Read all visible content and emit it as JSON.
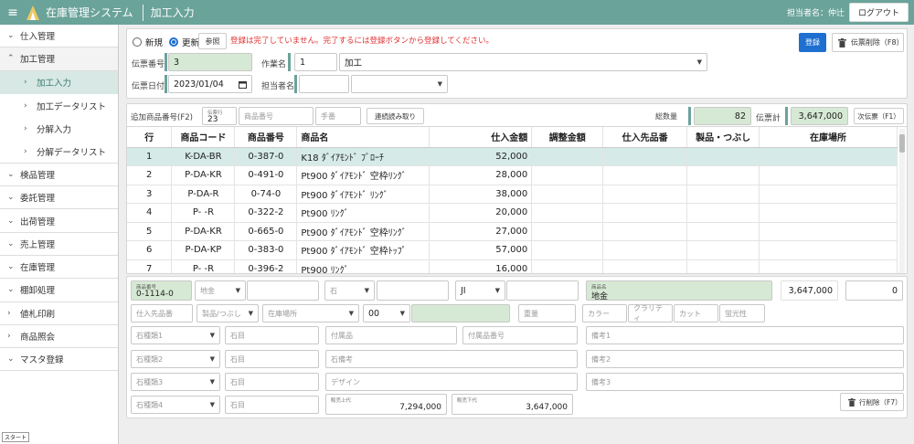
{
  "header": {
    "app_title": "在庫管理システム",
    "page_name": "加工入力",
    "user_label": "担当者名：仲辻",
    "logout_label": "ログアウト"
  },
  "sidebar": {
    "items": [
      {
        "label": "仕入管理",
        "chev": "⌄"
      },
      {
        "label": "加工管理",
        "chev": "⌃"
      },
      {
        "label": "加工入力",
        "chev": "›"
      },
      {
        "label": "加工データリスト",
        "chev": "›"
      },
      {
        "label": "分解入力",
        "chev": "›"
      },
      {
        "label": "分解データリスト",
        "chev": "›"
      },
      {
        "label": "検品管理",
        "chev": "⌄"
      },
      {
        "label": "委託管理",
        "chev": "⌄"
      },
      {
        "label": "出荷管理",
        "chev": "⌄"
      },
      {
        "label": "売上管理",
        "chev": "⌄"
      },
      {
        "label": "在庫管理",
        "chev": "⌄"
      },
      {
        "label": "棚卸処理",
        "chev": "⌄"
      },
      {
        "label": "値札印刷",
        "chev": "›"
      },
      {
        "label": "商品照会",
        "chev": "›"
      },
      {
        "label": "マスタ登録",
        "chev": "⌄"
      }
    ],
    "start_label": "スタート"
  },
  "form": {
    "radio_new": "新規",
    "radio_update": "更新",
    "ref_button": "参照",
    "warning": "登録は完了していません。完了するには登録ボタンから登録してください。",
    "register_button": "登録",
    "delete_slip_button": "伝票削除（F8）",
    "slip_no_label": "伝票番号",
    "slip_no_value": "3",
    "work_name_label": "作業名",
    "work_code_value": "1",
    "work_name_value": "加工",
    "slip_date_label": "伝票日付",
    "slip_date_value": "2023/01/04",
    "staff_label": "担当者名"
  },
  "summary": {
    "add_label": "追加商品番号(F2)",
    "line_no_caption": "伝票行",
    "line_no_value": "23",
    "product_no_ph": "商品番号",
    "hand_ph": "手番",
    "continuous_button": "連続読み取り",
    "total_qty_label": "総数量",
    "total_qty_value": "82",
    "slip_total_label": "伝票計",
    "slip_total_value": "3,647,000",
    "next_slip_button": "次伝票（F1）"
  },
  "table": {
    "headers": [
      "行",
      "商品コード",
      "商品番号",
      "商品名",
      "仕入金額",
      "調整金額",
      "仕入先品番",
      "製品・つぶし",
      "在庫場所"
    ],
    "rows": [
      [
        "1",
        "K-DA-BR",
        "0-387-0",
        "K18 ﾀﾞｲｱﾓﾝﾄﾞ ﾌﾞﾛｰﾁ",
        "52,000",
        "",
        "",
        "",
        ""
      ],
      [
        "2",
        "P-DA-KR",
        "0-491-0",
        "Pt900 ﾀﾞｲｱﾓﾝﾄﾞ 空枠ﾘﾝｸﾞ",
        "28,000",
        "",
        "",
        "",
        ""
      ],
      [
        "3",
        "P-DA-R",
        "0-74-0",
        "Pt900 ﾀﾞｲｱﾓﾝﾄﾞ ﾘﾝｸﾞ",
        "38,000",
        "",
        "",
        "",
        ""
      ],
      [
        "4",
        "P- -R",
        "0-322-2",
        "Pt900 ﾘﾝｸﾞ",
        "20,000",
        "",
        "",
        "",
        ""
      ],
      [
        "5",
        "P-DA-KR",
        "0-665-0",
        "Pt900 ﾀﾞｲｱﾓﾝﾄﾞ 空枠ﾘﾝｸﾞ",
        "27,000",
        "",
        "",
        "",
        ""
      ],
      [
        "6",
        "P-DA-KP",
        "0-383-0",
        "Pt900 ﾀﾞｲｱﾓﾝﾄﾞ 空枠ﾄｯﾌﾟ",
        "57,000",
        "",
        "",
        "",
        ""
      ],
      [
        "7",
        "P- -R",
        "0-396-2",
        "Pt900 ﾘﾝｸﾞ",
        "16,000",
        "",
        "",
        "",
        ""
      ]
    ]
  },
  "detail": {
    "product_no_caption": "商品番号",
    "product_no_value": "0-1114-0",
    "metal_ph": "地金",
    "stone_ph": "石",
    "ji_value": "JI",
    "product_name_caption": "商品名",
    "product_name_value": "地金",
    "amount_value": "3,647,000",
    "zero_value": "0",
    "supplier_no_ph": "仕入先品番",
    "product_crush_ph": "製品/つぶし",
    "stock_place_ph": "在庫場所",
    "oo_value": "00",
    "weight_ph": "重量",
    "color_ph": "カラー",
    "clarity_ph": "クラリティ",
    "cut_ph": "カット",
    "fluor_ph": "蛍光性",
    "stone_type1_ph": "石種類1",
    "stone_type2_ph": "石種類2",
    "stone_type3_ph": "石種類3",
    "stone_type4_ph": "石種類4",
    "stone_eye_ph": "石目",
    "accessory_ph": "付属品",
    "accessory_no_ph": "付属品番号",
    "stone_note_ph": "石備考",
    "design_ph": "デザイン",
    "note1_ph": "備考1",
    "note2_ph": "備考2",
    "note3_ph": "備考3",
    "sale_upper_caption": "販売上代",
    "sale_upper_value": "7,294,000",
    "sale_lower_caption": "販売下代",
    "sale_lower_value": "3,647,000",
    "delete_row_button": "行削除（F7）"
  }
}
